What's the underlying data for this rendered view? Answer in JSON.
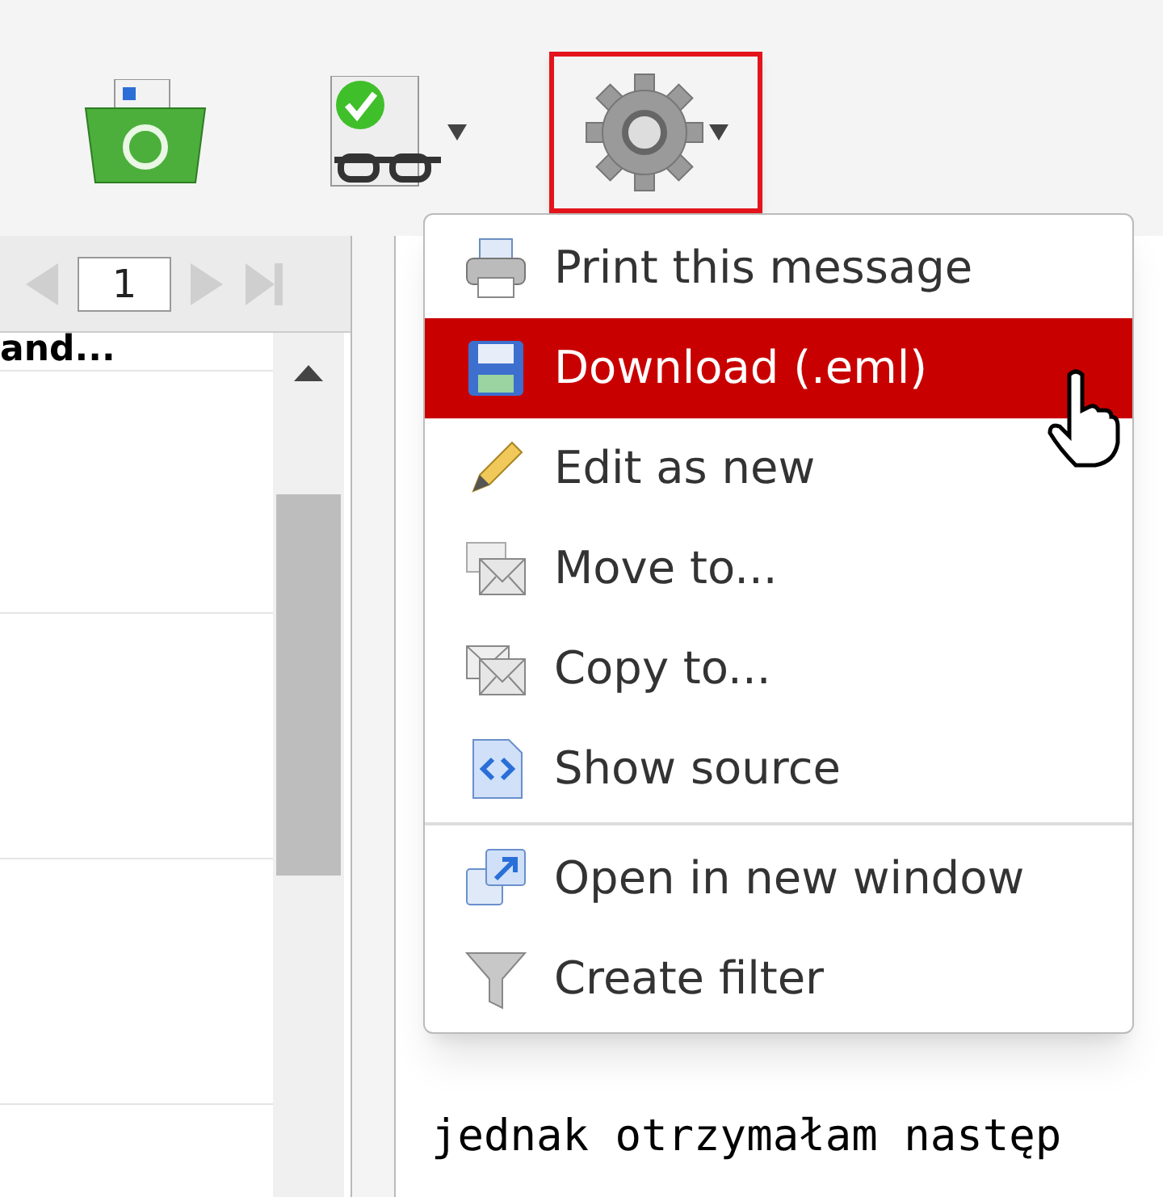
{
  "toolbar": {
    "buttons": [
      {
        "kind": "delete",
        "selected": false,
        "dropdown": false
      },
      {
        "kind": "mark",
        "selected": false,
        "dropdown": true
      },
      {
        "kind": "more",
        "selected": true,
        "dropdown": true
      }
    ]
  },
  "pager": {
    "page": "1"
  },
  "message_list": {
    "rows": [
      {
        "text": "and..."
      }
    ]
  },
  "menu": {
    "items": [
      {
        "label": "Print this message",
        "kind": "print",
        "selected": false,
        "separator_before": false
      },
      {
        "label": "Download (.eml)",
        "kind": "save",
        "selected": true,
        "separator_before": false
      },
      {
        "label": "Edit as new",
        "kind": "edit",
        "selected": false,
        "separator_before": false
      },
      {
        "label": "Move to...",
        "kind": "move",
        "selected": false,
        "separator_before": false
      },
      {
        "label": "Copy to...",
        "kind": "copy",
        "selected": false,
        "separator_before": false
      },
      {
        "label": "Show source",
        "kind": "source",
        "selected": false,
        "separator_before": false
      },
      {
        "label": "Open in new window",
        "kind": "window",
        "selected": false,
        "separator_before": true
      },
      {
        "label": "Create filter",
        "kind": "filter",
        "selected": false,
        "separator_before": false
      }
    ]
  },
  "message": {
    "body_line": "jednak otrzymałam następ"
  }
}
